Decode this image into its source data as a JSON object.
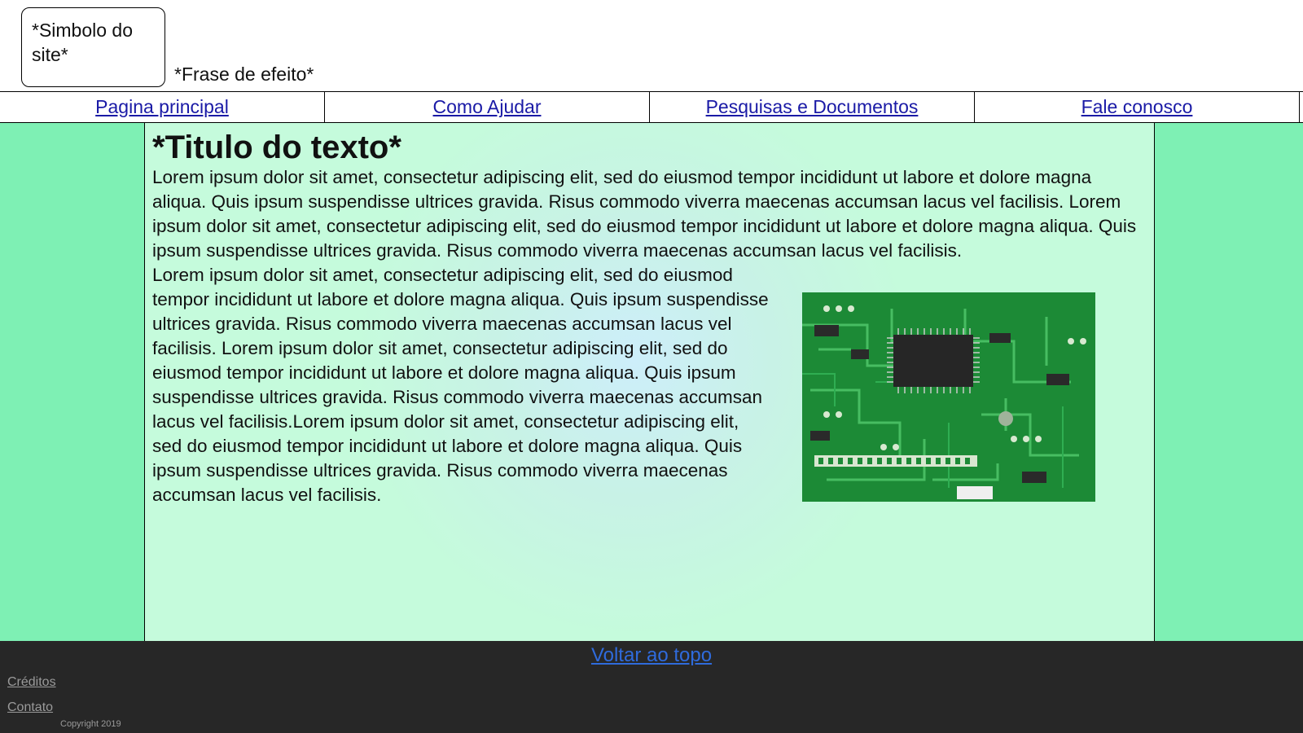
{
  "header": {
    "logo_text": "*Simbolo do site*",
    "slogan": "*Frase de efeito*"
  },
  "nav": {
    "items": [
      {
        "label": "Pagina principal"
      },
      {
        "label": "Como Ajudar"
      },
      {
        "label": "Pesquisas e Documentos"
      },
      {
        "label": "Fale conosco"
      }
    ]
  },
  "main": {
    "title": "*Titulo do texto*",
    "paragraph1": "Lorem ipsum dolor sit amet, consectetur adipiscing elit, sed do eiusmod tempor incididunt ut labore et dolore magna aliqua. Quis ipsum suspendisse ultrices gravida. Risus commodo viverra maecenas accumsan lacus vel facilisis. Lorem ipsum dolor sit amet, consectetur adipiscing elit, sed do eiusmod tempor incididunt ut labore et dolore magna aliqua. Quis ipsum suspendisse ultrices gravida. Risus commodo viverra maecenas accumsan lacus vel facilisis.",
    "paragraph2": "Lorem ipsum dolor sit amet, consectetur adipiscing elit, sed do eiusmod tempor incididunt ut labore et dolore magna aliqua. Quis ipsum suspendisse ultrices gravida. Risus commodo viverra maecenas accumsan lacus vel facilisis. Lorem ipsum dolor sit amet, consectetur adipiscing elit, sed do eiusmod tempor incididunt ut labore et dolore magna aliqua. Quis ipsum suspendisse ultrices gravida. Risus commodo viverra maecenas accumsan lacus vel facilisis.Lorem ipsum dolor sit amet, consectetur adipiscing elit, sed do eiusmod tempor incididunt ut labore et dolore magna aliqua. Quis ipsum suspendisse ultrices gravida. Risus commodo viverra maecenas accumsan lacus vel facilisis.",
    "image_icon": "circuit-board-image"
  },
  "footer": {
    "back_to_top": "Voltar ao topo",
    "credits": "Créditos",
    "contact": "Contato",
    "copyright": "Copyright 2019"
  },
  "colors": {
    "side_background": "#7ef0b4",
    "content_background": "#c5fbdc",
    "footer_background": "#272727",
    "nav_link": "#1a1aa6",
    "footer_link": "#2f6bdc"
  }
}
